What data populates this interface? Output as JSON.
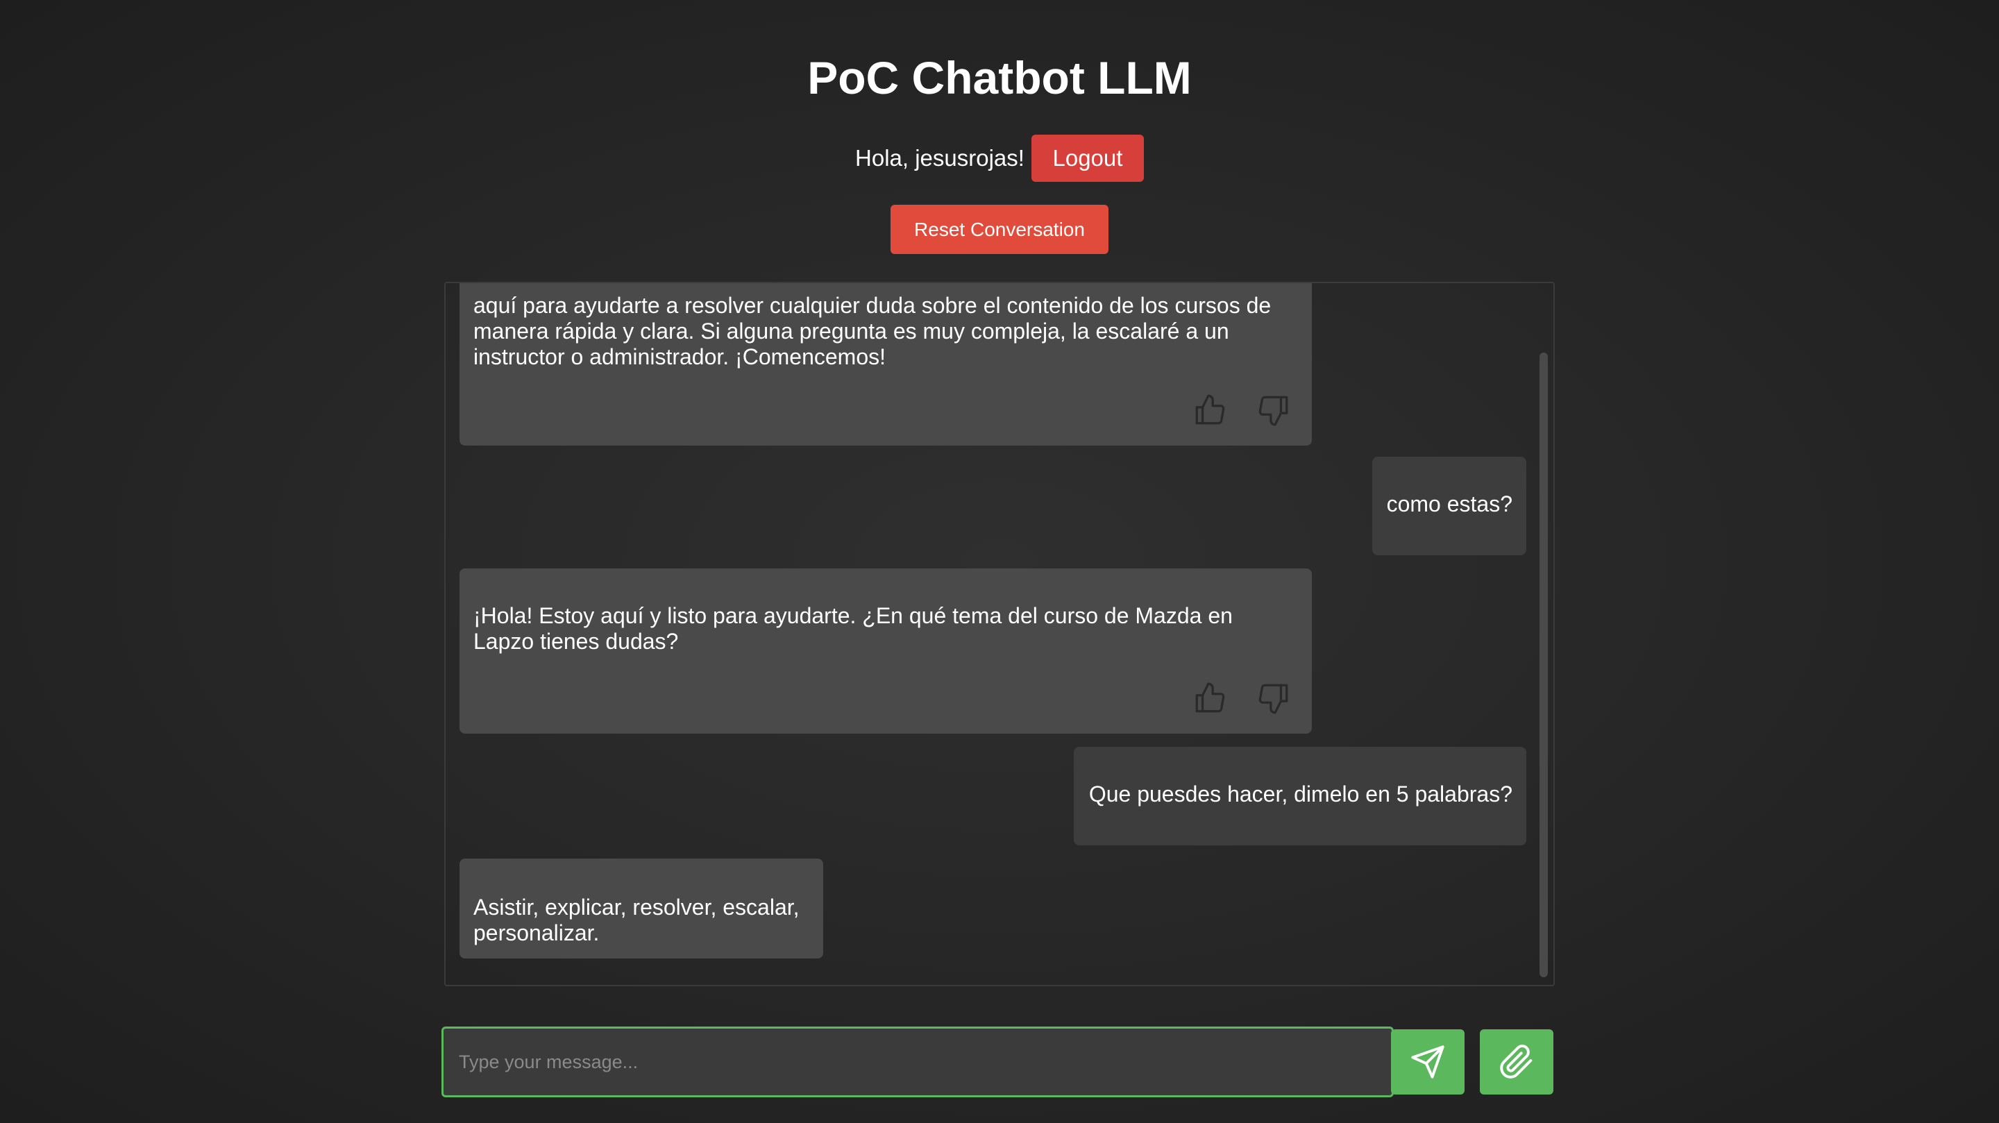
{
  "header": {
    "title": "PoC Chatbot LLM",
    "greeting": "Hola, jesusrojas!",
    "logout_label": "Logout",
    "reset_label": "Reset Conversation"
  },
  "messages": [
    {
      "role": "bot",
      "text": "aquí para ayudarte a resolver cualquier duda sobre el contenido de los cursos de manera rápida y clara. Si alguna pregunta es muy compleja, la escalaré a un instructor o administrador. ¡Comencemos!",
      "feedback": true
    },
    {
      "role": "user",
      "text": "como estas?"
    },
    {
      "role": "bot",
      "text": "¡Hola! Estoy aquí y listo para ayudarte. ¿En qué tema del curso de Mazda en Lapzo tienes dudas?",
      "feedback": true
    },
    {
      "role": "user",
      "text": "Que puesdes hacer, dimelo en 5 palabras?"
    },
    {
      "role": "bot",
      "text": "Asistir, explicar, resolver, escalar, personalizar.",
      "feedback": false
    }
  ],
  "composer": {
    "placeholder": "Type your message...",
    "value": ""
  },
  "icons": {
    "like": "thumbs-up-icon",
    "dislike": "thumbs-down-icon",
    "send": "paper-plane-icon",
    "attach": "paperclip-icon"
  },
  "colors": {
    "accent_green": "#5cb85c",
    "danger_red": "#d63f3a",
    "reset_red": "#e04b3c",
    "bot_bubble": "#4a4a4a",
    "user_bubble": "#3d3d3d"
  }
}
